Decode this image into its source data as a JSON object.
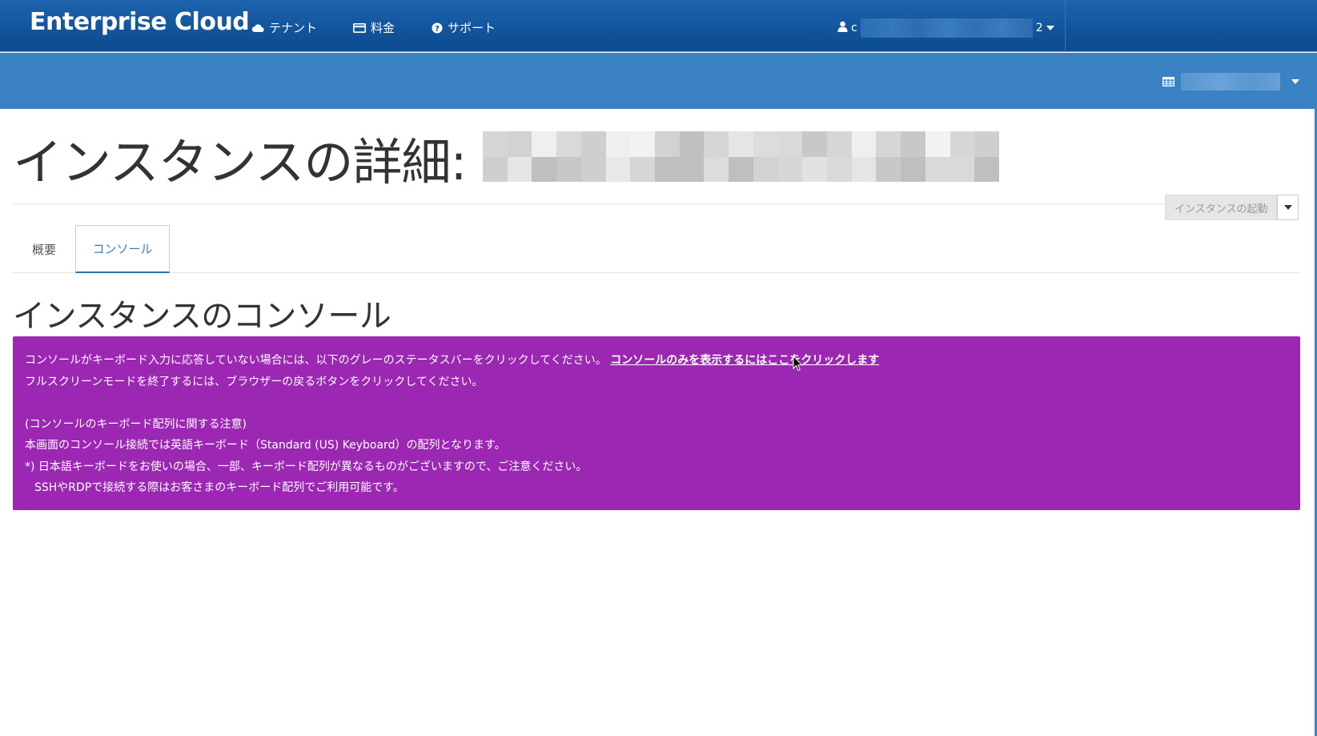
{
  "navbar": {
    "brand": "Enterprise Cloud",
    "links": [
      {
        "label": "テナント",
        "icon": "cloud-icon"
      },
      {
        "label": "料金",
        "icon": "credit-card-icon"
      },
      {
        "label": "サポート",
        "icon": "question-circle-icon"
      }
    ],
    "user_prefix": "c",
    "user_suffix": "2"
  },
  "subbar": {
    "project_icon": "table-icon"
  },
  "page": {
    "title": "インスタンスの詳細:",
    "launch_button": "インスタンスの起動"
  },
  "tabs": [
    {
      "label": "概要",
      "active": false
    },
    {
      "label": "コンソール",
      "active": true
    }
  ],
  "section_title": "インスタンスのコンソール",
  "infobox": {
    "color": "#9b27b3",
    "line1": "コンソールがキーボード入力に応答していない場合には、以下のグレーのステータスバーをクリックしてください。",
    "line1_link": "コンソールのみを表示するにはここをクリックします",
    "line2": "フルスクリーンモードを終了するには、ブラウザーの戻るボタンをクリックしてください。",
    "line3": "(コンソールのキーボード配列に関する注意)",
    "line4": "本画面のコンソール接続では英語キーボード（Standard (US) Keyboard）の配列となります。",
    "line5": "*) 日本語キーボードをお使いの場合、一部、キーボード配列が異なるものがございますので、ご注意ください。",
    "line6": "SSHやRDPで接続する際はお客さまのキーボード配列でご利用可能です。"
  },
  "colors": {
    "navbar": "#0b4a8e",
    "subbar": "#3b82c4",
    "active_tab": "#3a7fc1"
  }
}
